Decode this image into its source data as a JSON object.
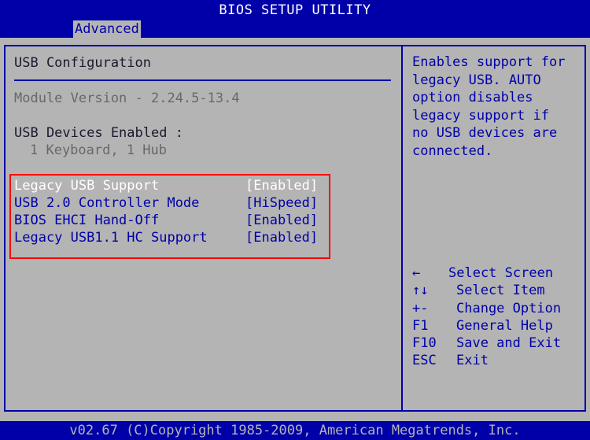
{
  "title": "BIOS SETUP UTILITY",
  "active_tab": "Advanced",
  "section": {
    "heading": "USB Configuration",
    "module_version": "Module Version - 2.24.5-13.4",
    "devices_label": "USB Devices Enabled :",
    "devices_value": "1 Keyboard, 1 Hub"
  },
  "options": [
    {
      "label": "Legacy USB Support",
      "value": "[Enabled]",
      "selected": true
    },
    {
      "label": "USB 2.0 Controller Mode",
      "value": "[HiSpeed]",
      "selected": false
    },
    {
      "label": "BIOS EHCI Hand-Off",
      "value": "[Enabled]",
      "selected": false
    },
    {
      "label": "Legacy USB1.1 HC Support",
      "value": "[Enabled]",
      "selected": false
    }
  ],
  "help": "Enables support for\nlegacy USB. AUTO\noption disables\nlegacy support if\nno USB devices are\nconnected.",
  "legend": [
    {
      "key": "←",
      "desc": "Select Screen"
    },
    {
      "key": "↑↓",
      "desc": "Select Item"
    },
    {
      "key": "+-",
      "desc": "Change Option"
    },
    {
      "key": "F1",
      "desc": "General Help"
    },
    {
      "key": "F10",
      "desc": "Save and Exit"
    },
    {
      "key": "ESC",
      "desc": "Exit"
    }
  ],
  "footer": "v02.67 (C)Copyright 1985-2009, American Megatrends, Inc.",
  "colors": {
    "background": "#b4b4b4",
    "accent_blue": "#0000a8",
    "selected_text": "#ffffff",
    "disabled_text": "#686868",
    "annotation_red": "#ff0000"
  }
}
